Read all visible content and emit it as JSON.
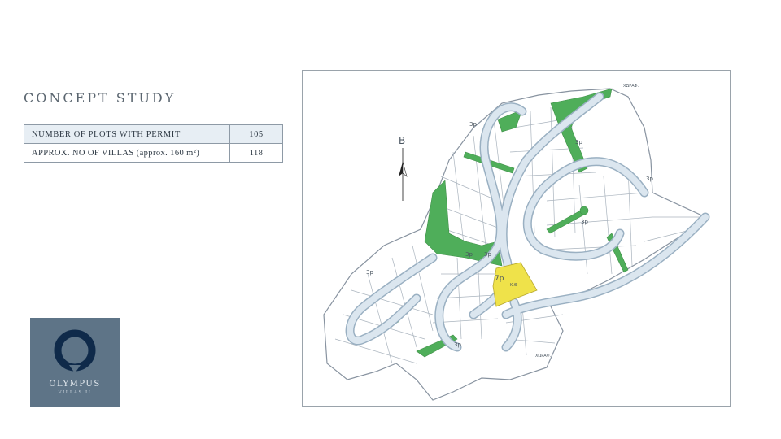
{
  "page": {
    "title": "CONCEPT STUDY"
  },
  "stats": {
    "rows": [
      {
        "label": "NUMBER OF PLOTS WITH PERMIT",
        "value": "105"
      },
      {
        "label": "APPROX. NO OF VILLAS (approx. 160 m²)",
        "value": "118"
      }
    ]
  },
  "logo": {
    "brand": "OLYMPUS",
    "sub": "VILLAS II"
  },
  "map": {
    "north_label": "B",
    "road_label_top": "ΧΩΡΑΦ.",
    "road_label_bottom": "ΧΩΡΑΦ.",
    "plot_label_yellow": "Κ.Θ",
    "labels": [
      "3p",
      "3p",
      "3p",
      "3p",
      "3p",
      "3p",
      "7p",
      "3p",
      "3p"
    ]
  },
  "colors": {
    "park_green": "#4fae5a",
    "plot_yellow": "#efe24a",
    "road_fill": "#dbe6ef",
    "road_edge": "#9ab0c2",
    "logo_bg": "#5e7487"
  }
}
